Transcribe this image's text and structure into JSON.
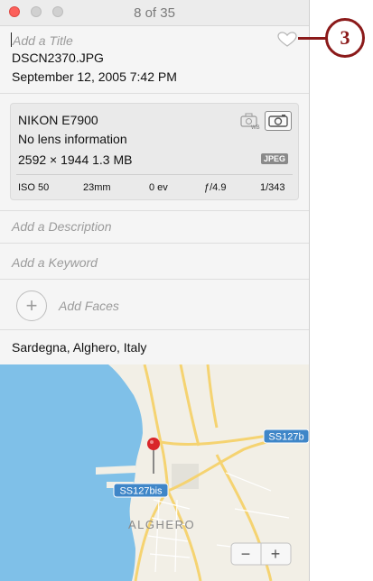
{
  "window": {
    "title": "8 of 35",
    "traffic_lights": [
      "close",
      "minimize",
      "zoom"
    ]
  },
  "photo": {
    "title_placeholder": "Add a Title",
    "filename": "DSCN2370.JPG",
    "date": "September 12, 2005   7:42 PM",
    "favorite_icon": "heart-icon"
  },
  "camera": {
    "model": "NIKON E7900",
    "lens": "No lens information",
    "dimensions": "2592 × 1944   1.3 MB",
    "format_badge": "JPEG",
    "icons": [
      "white-balance-icon",
      "camera-flash-icon"
    ],
    "exif": {
      "iso": "ISO 50",
      "focal_length": "23mm",
      "exposure_comp": "0 ev",
      "aperture": "ƒ/4.9",
      "shutter": "1/343"
    }
  },
  "fields": {
    "description_placeholder": "Add a Description",
    "keyword_placeholder": "Add a Keyword",
    "faces_placeholder": "Add Faces",
    "faces_add_symbol": "+"
  },
  "location": {
    "text": "Sardegna, Alghero, Italy",
    "map": {
      "city_label": "ALGHERO",
      "road_label_1": "SS127bis",
      "road_label_2": "SS127b",
      "zoom_out": "−",
      "zoom_in": "+",
      "colors": {
        "water": "#7fc0e8",
        "land": "#f2efe6",
        "road": "#f5d371",
        "shield": "#3f86c8",
        "pin": "#d9252a"
      }
    }
  },
  "callout": {
    "number": "3",
    "color": "#8b1a1a"
  }
}
